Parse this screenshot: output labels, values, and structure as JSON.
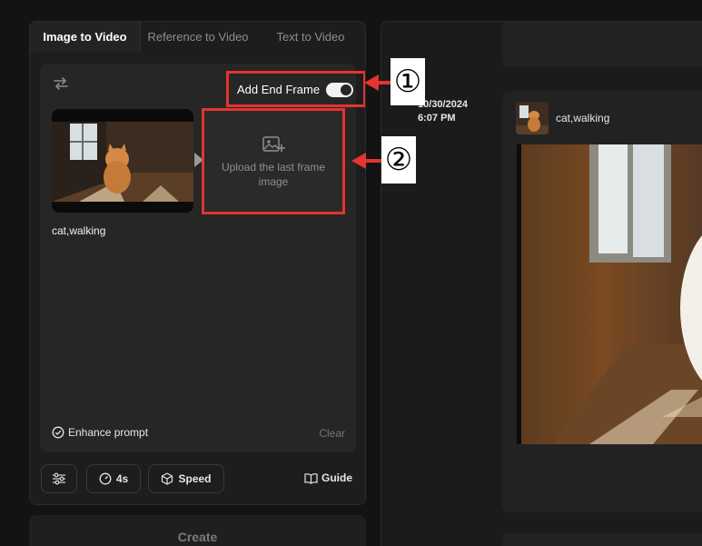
{
  "tabs": [
    {
      "label": "Image to Video",
      "active": true
    },
    {
      "label": "Reference to Video",
      "active": false
    },
    {
      "label": "Text to Video",
      "active": false
    }
  ],
  "end_frame": {
    "label": "Add End Frame",
    "enabled": true
  },
  "upload": {
    "label": "Upload the last frame image"
  },
  "prompt_text": "cat,walking",
  "enhance_label": "Enhance prompt",
  "clear_label": "Clear",
  "toolbar": {
    "duration": "4s",
    "speed": "Speed",
    "guide": "Guide"
  },
  "create_label": "Create",
  "history": [
    {
      "date": "10/30/2024",
      "time": "6:07 PM",
      "prompt": "cat,walking"
    }
  ],
  "annotations": {
    "badge1": "①",
    "badge2": "②"
  },
  "colors": {
    "highlight": "#e3342f",
    "background": "#131313",
    "panel": "#1d1d1d"
  }
}
